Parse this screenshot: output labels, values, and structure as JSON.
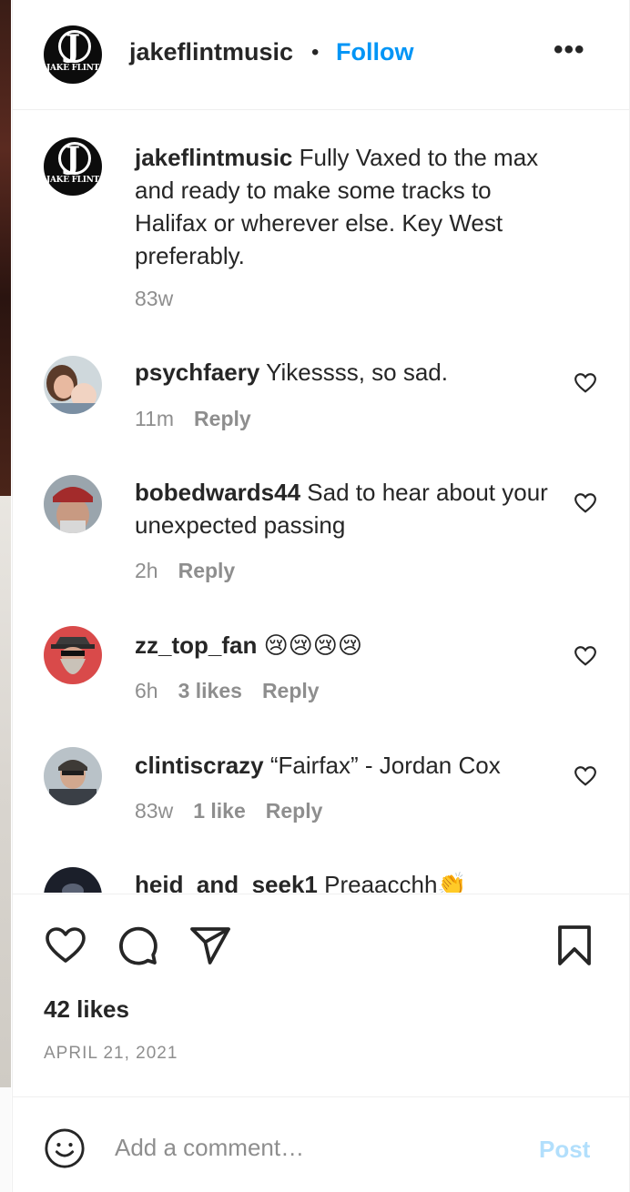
{
  "header": {
    "username": "jakeflintmusic",
    "separator": "•",
    "follow_label": "Follow",
    "more_label": "•••",
    "logo_text": "JAKE FLINT"
  },
  "caption": {
    "username": "jakeflintmusic",
    "text": "Fully Vaxed to the max and ready to make some tracks to Halifax or wherever else. Key West preferably.",
    "time": "83w"
  },
  "comments": [
    {
      "username": "psychfaery",
      "text": "Yikessss, so sad.",
      "time": "11m",
      "likes": "",
      "reply": "Reply"
    },
    {
      "username": "bobedwards44",
      "text": "Sad to hear about your unexpected passing",
      "time": "2h",
      "likes": "",
      "reply": "Reply"
    },
    {
      "username": "zz_top_fan",
      "text": "😢😢😢😢",
      "time": "6h",
      "likes": "3 likes",
      "reply": "Reply"
    },
    {
      "username": "clintiscrazy",
      "text": "“Fairfax” - Jordan Cox",
      "time": "83w",
      "likes": "1 like",
      "reply": "Reply"
    },
    {
      "username": "heid_and_seek1",
      "text": "Preaacchh👏",
      "time": "",
      "likes": "",
      "reply": ""
    }
  ],
  "post": {
    "likes_label": "42 likes",
    "date_label": "APRIL 21, 2021"
  },
  "composer": {
    "placeholder": "Add a comment…",
    "post_label": "Post"
  },
  "colors": {
    "accent": "#0095f6",
    "post_disabled": "#b2dffc",
    "text": "#262626",
    "muted": "#8e8e8e"
  }
}
